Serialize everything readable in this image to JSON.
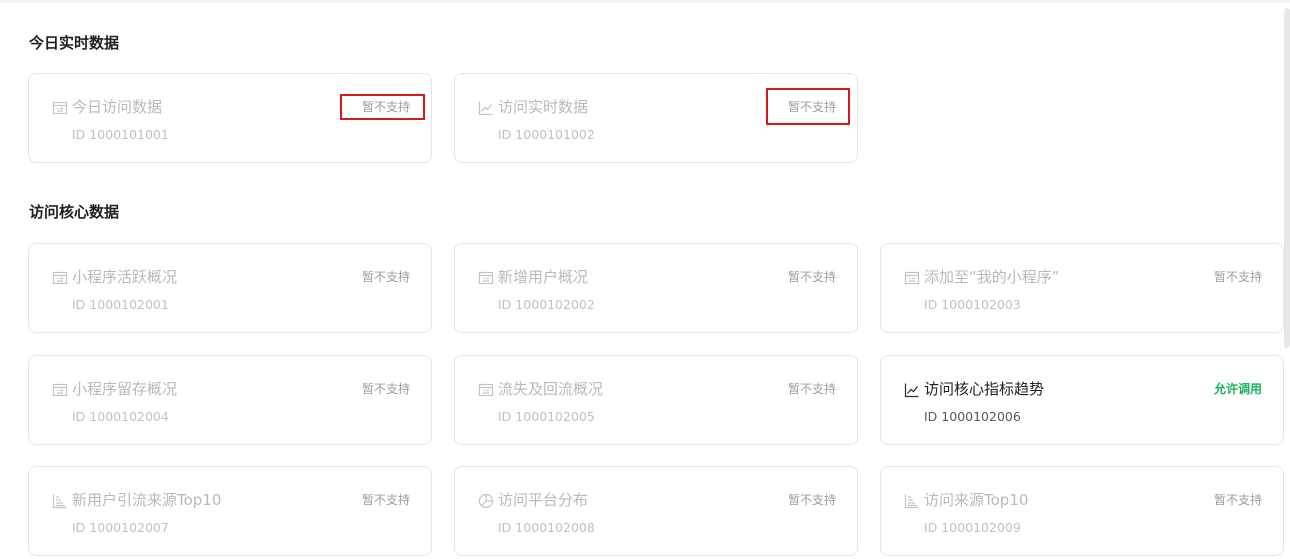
{
  "sections": [
    {
      "title": "今日实时数据",
      "cards": [
        {
          "name": "今日访问数据",
          "id": "ID 1000101001",
          "status": "暂不支持",
          "icon": "calendar-icon"
        },
        {
          "name": "访问实时数据",
          "id": "ID 1000101002",
          "status": "暂不支持",
          "icon": "line-chart-icon"
        }
      ]
    },
    {
      "title": "访问核心数据",
      "cards": [
        {
          "name": "小程序活跃概况",
          "id": "ID 1000102001",
          "status": "暂不支持",
          "icon": "calendar-icon"
        },
        {
          "name": "新增用户概况",
          "id": "ID 1000102002",
          "status": "暂不支持",
          "icon": "calendar-icon"
        },
        {
          "name": "添加至“我的小程序”",
          "id": "ID 1000102003",
          "status": "暂不支持",
          "icon": "calendar-icon"
        },
        {
          "name": "小程序留存概况",
          "id": "ID 1000102004",
          "status": "暂不支持",
          "icon": "calendar-icon"
        },
        {
          "name": "流失及回流概况",
          "id": "ID 1000102005",
          "status": "暂不支持",
          "icon": "calendar-icon"
        },
        {
          "name": "访问核心指标趋势",
          "id": "ID 1000102006",
          "status": "允许调用",
          "icon": "line-chart-icon",
          "enabled": true
        },
        {
          "name": "新用户引流来源Top10",
          "id": "ID 1000102007",
          "status": "暂不支持",
          "icon": "bar-list-icon"
        },
        {
          "name": "访问平台分布",
          "id": "ID 1000102008",
          "status": "暂不支持",
          "icon": "pie-chart-icon"
        },
        {
          "name": "访问来源Top10",
          "id": "ID 1000102009",
          "status": "暂不支持",
          "icon": "bar-list-icon"
        }
      ]
    }
  ],
  "colors": {
    "enabled_status": "#19b35c",
    "highlight": "#d6181f"
  }
}
